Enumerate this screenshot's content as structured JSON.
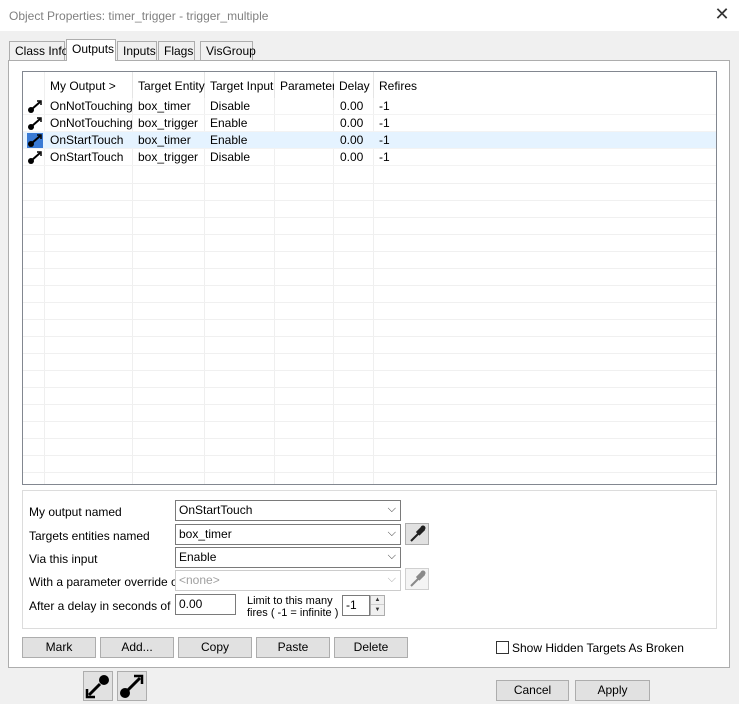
{
  "window": {
    "title": "Object Properties: timer_trigger - trigger_multiple"
  },
  "tabs": [
    {
      "label": "Class Info"
    },
    {
      "label": "Outputs"
    },
    {
      "label": "Inputs"
    },
    {
      "label": "Flags"
    },
    {
      "label": "VisGroup"
    }
  ],
  "outputs_table": {
    "headers": [
      "My Output  >",
      "Target Entity",
      "Target Input",
      "Parameter",
      "Delay",
      "Refires"
    ],
    "rows": [
      {
        "output": "OnNotTouching",
        "target_entity": "box_timer",
        "target_input": "Disable",
        "parameter": "",
        "delay": "0.00",
        "refires": "-1",
        "selected": false
      },
      {
        "output": "OnNotTouching",
        "target_entity": "box_trigger",
        "target_input": "Enable",
        "parameter": "",
        "delay": "0.00",
        "refires": "-1",
        "selected": false
      },
      {
        "output": "OnStartTouch",
        "target_entity": "box_timer",
        "target_input": "Enable",
        "parameter": "",
        "delay": "0.00",
        "refires": "-1",
        "selected": true
      },
      {
        "output": "OnStartTouch",
        "target_entity": "box_trigger",
        "target_input": "Disable",
        "parameter": "",
        "delay": "0.00",
        "refires": "-1",
        "selected": false
      }
    ]
  },
  "editor": {
    "my_output_label": "My output named",
    "my_output_value": "OnStartTouch",
    "targets_label": "Targets entities named",
    "targets_value": "box_timer",
    "via_input_label": "Via this input",
    "via_input_value": "Enable",
    "parameter_label": "With a parameter override of",
    "parameter_value": "<none>",
    "delay_label": "After a delay in seconds of",
    "delay_value": "0.00",
    "limit_label_line1": "Limit to this many",
    "limit_label_line2": "fires ( -1 = infinite )",
    "limit_value": "-1"
  },
  "buttons": {
    "mark": "Mark",
    "add": "Add...",
    "copy": "Copy",
    "paste": "Paste",
    "delete": "Delete",
    "show_hidden_label": "Show Hidden Targets As Broken",
    "cancel": "Cancel",
    "apply": "Apply"
  },
  "icons": {
    "row_icon": "output-connection-icon",
    "picker_icon": "eyedropper-icon",
    "close_icon": "close-icon",
    "close_glyph": "✕",
    "dropdown_glyph": "⌵"
  },
  "colors": {
    "selected_row": "#e5f3ff",
    "selected_icon_bg": "#3a7bd5"
  }
}
